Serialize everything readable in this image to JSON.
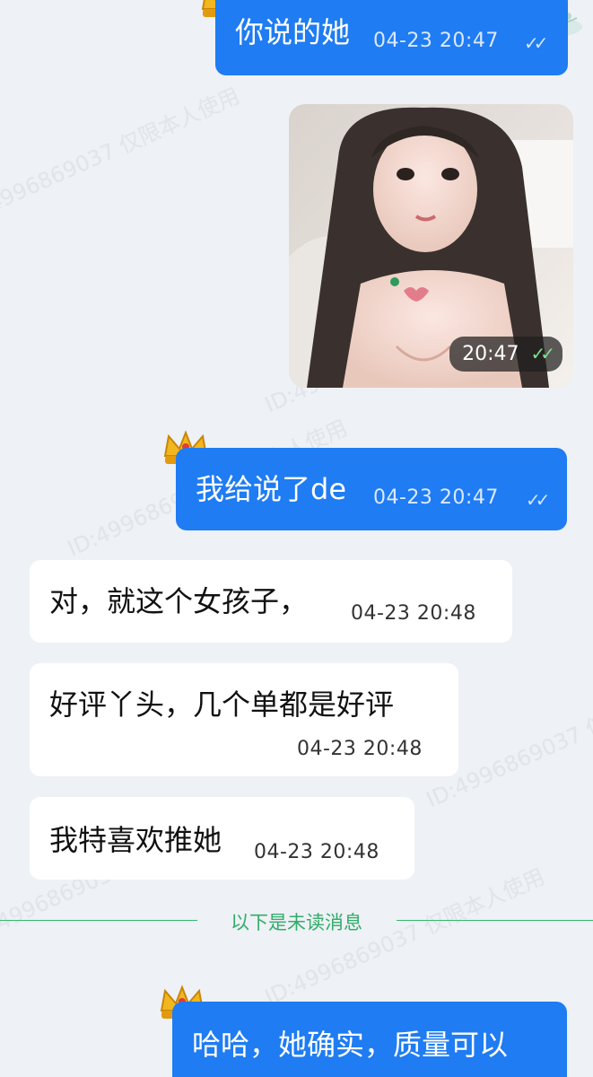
{
  "messages": [
    {
      "side": "out",
      "text": "你说的她",
      "time": "04-23 20:47"
    },
    {
      "side": "out",
      "type": "image",
      "time": "20:47"
    },
    {
      "side": "out",
      "text": "我给说了de",
      "time": "04-23 20:47"
    },
    {
      "side": "in",
      "text": "对，就这个女孩子，",
      "time": "04-23 20:48"
    },
    {
      "side": "in",
      "text": "好评丫头，几个单都是好评",
      "time": "04-23 20:48"
    },
    {
      "side": "in",
      "text": "我特喜欢推她",
      "time": "04-23 20:48"
    },
    {
      "side": "out",
      "text": "哈哈，她确实，质量可以",
      "time": ""
    }
  ],
  "unread_divider": "以下是未读消息",
  "watermark": {
    "text": "ID:4996869037 仅限本人使用"
  },
  "icons": {
    "read_receipt": "double-check-icon",
    "vip_badge": "crown-icon",
    "logo": "logo-mark-icon"
  },
  "colors": {
    "outgoing_bubble": "#1f7cf2",
    "incoming_bubble": "#ffffff",
    "background": "#eef1f5",
    "divider": "#39b66f"
  }
}
